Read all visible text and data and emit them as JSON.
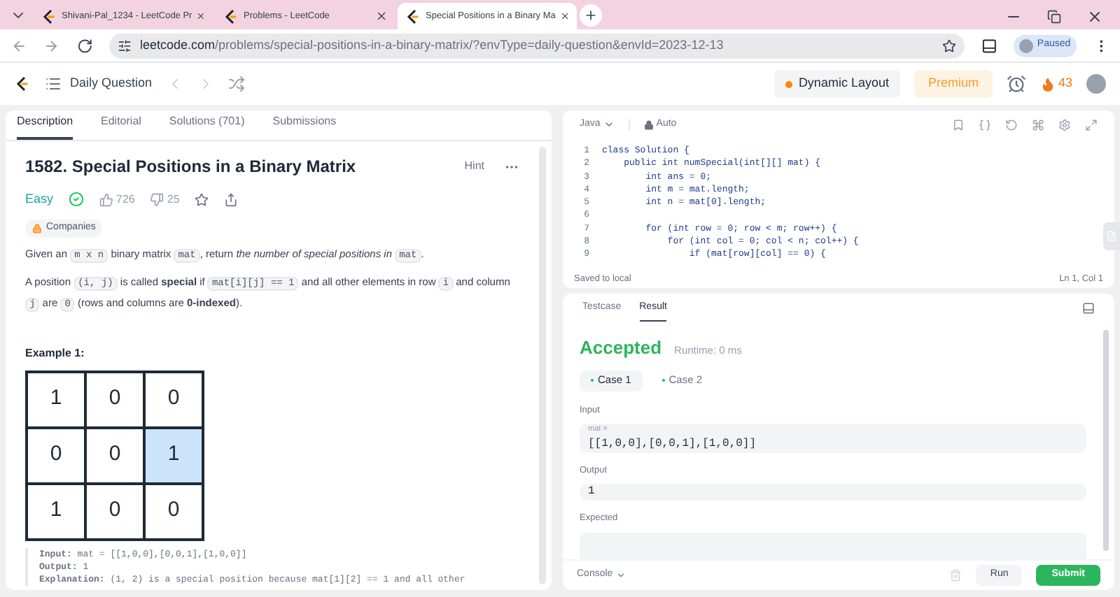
{
  "browser": {
    "tabs": [
      {
        "title": "Shivani-Pal_1234 - LeetCode Pr",
        "selected": false
      },
      {
        "title": "Problems - LeetCode",
        "selected": false
      },
      {
        "title": "Special Positions in a Binary Ma",
        "selected": true
      }
    ],
    "url_host": "leetcode.com",
    "url_path": "/problems/special-positions-in-a-binary-matrix/?envType=daily-question&envId=2023-12-13",
    "profile": "Paused"
  },
  "header": {
    "title": "Daily Question",
    "dynamic_layout": "Dynamic Layout",
    "premium": "Premium",
    "streak": "43"
  },
  "left_tabs": [
    {
      "label": "Description",
      "selected": true
    },
    {
      "label": "Editorial",
      "selected": false
    },
    {
      "label": "Solutions (701)",
      "selected": false
    },
    {
      "label": "Submissions",
      "selected": false
    }
  ],
  "problem": {
    "title": "1582. Special Positions in a Binary Matrix",
    "hint": "Hint",
    "difficulty": "Easy",
    "likes": "726",
    "dislikes": "25",
    "companies": "Companies",
    "paragraphs": [
      [
        {
          "kind": "text",
          "text": "Given an "
        },
        {
          "kind": "code",
          "text": "m x n"
        },
        {
          "kind": "text",
          "text": " binary matrix "
        },
        {
          "kind": "code",
          "text": "mat"
        },
        {
          "kind": "text",
          "text": ", return "
        },
        {
          "kind": "em",
          "text": "the number of special positions in "
        },
        {
          "kind": "code",
          "text": "mat"
        },
        {
          "kind": "text",
          "text": "."
        }
      ],
      [
        {
          "kind": "text",
          "text": "A position "
        },
        {
          "kind": "code",
          "text": "(i, j)"
        },
        {
          "kind": "text",
          "text": " is called "
        },
        {
          "kind": "strong",
          "text": "special"
        },
        {
          "kind": "text",
          "text": " if "
        },
        {
          "kind": "code",
          "text": "mat[i][j] == 1"
        },
        {
          "kind": "text",
          "text": " and all other elements in row "
        },
        {
          "kind": "code",
          "text": "i"
        },
        {
          "kind": "text",
          "text": " and column "
        },
        {
          "kind": "code",
          "text": "j"
        },
        {
          "kind": "text",
          "text": " are "
        },
        {
          "kind": "code",
          "text": "0"
        },
        {
          "kind": "text",
          "text": " (rows and columns are "
        },
        {
          "kind": "strong",
          "text": "0-indexed"
        },
        {
          "kind": "text",
          "text": ")."
        }
      ]
    ],
    "example_title": "Example 1:",
    "matrix": [
      [
        {
          "value": "1",
          "highlighted": false
        },
        {
          "value": "0",
          "highlighted": false
        },
        {
          "value": "0",
          "highlighted": false
        }
      ],
      [
        {
          "value": "0",
          "highlighted": false
        },
        {
          "value": "0",
          "highlighted": false
        },
        {
          "value": "1",
          "highlighted": true
        }
      ],
      [
        {
          "value": "1",
          "highlighted": false
        },
        {
          "value": "0",
          "highlighted": false
        },
        {
          "value": "0",
          "highlighted": false
        }
      ]
    ],
    "example_lines": [
      "**Input:** mat = [[1,0,0],[0,0,1],[1,0,0]]",
      "**Output:** 1",
      "**Explanation:** (1, 2) is a special position because mat[1][2] == 1 and all other"
    ]
  },
  "editor": {
    "language": "Java",
    "mode": "Auto",
    "lines": [
      {
        "number": "1",
        "code": "class Solution {"
      },
      {
        "number": "2",
        "code": "    public int numSpecial(int[][] mat) {"
      },
      {
        "number": "3",
        "code": "        int ans = 0;"
      },
      {
        "number": "4",
        "code": "        int m = mat.length;"
      },
      {
        "number": "5",
        "code": "        int n = mat[0].length;"
      },
      {
        "number": "6"
      },
      {
        "number": "7",
        "code": "        for (int row = 0; row < m; row++) {"
      },
      {
        "number": "8",
        "code": "            for (int col = 0; col < n; col++) {"
      },
      {
        "number": "9",
        "code": "                if (mat[row][col] == 0) {"
      }
    ],
    "saved": "Saved to local",
    "cursor": "Ln 1, Col 1"
  },
  "result_tabs": [
    {
      "label": "Testcase",
      "selected": false
    },
    {
      "label": "Result",
      "selected": true
    }
  ],
  "result": {
    "status": "Accepted",
    "runtime": "Runtime: 0 ms",
    "cases": [
      {
        "label": "Case 1",
        "selected": true
      },
      {
        "label": "Case 2",
        "selected": false
      }
    ],
    "input_label": "Input",
    "input_var": "mat =",
    "input_value": "[[1,0,0],[0,0,1],[1,0,0]]",
    "output_label": "Output",
    "output_value": "1",
    "expected_label": "Expected"
  },
  "footer": {
    "console": "Console",
    "run": "Run",
    "submit": "Submit"
  }
}
